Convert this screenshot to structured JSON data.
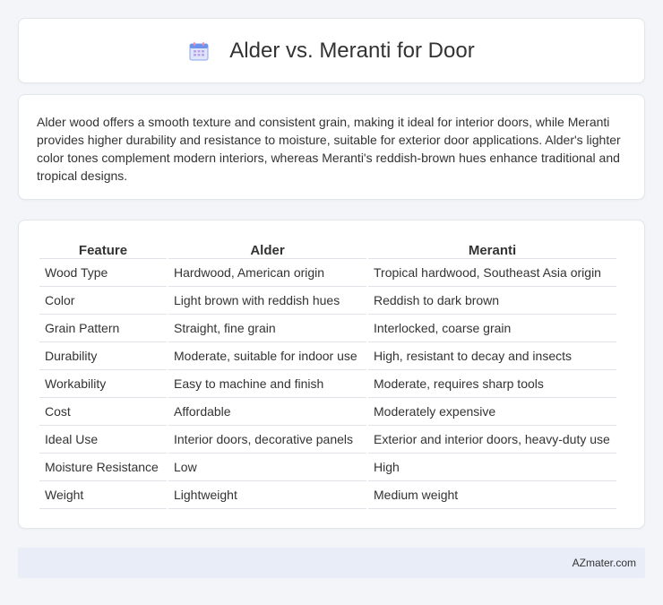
{
  "header": {
    "title": "Alder vs. Meranti for Door",
    "icon": "calendar-icon"
  },
  "description": {
    "text": "Alder wood offers a smooth texture and consistent grain, making it ideal for interior doors, while Meranti provides higher durability and resistance to moisture, suitable for exterior door applications. Alder's lighter color tones complement modern interiors, whereas Meranti's reddish-brown hues enhance traditional and tropical designs."
  },
  "table": {
    "headers": [
      "Feature",
      "Alder",
      "Meranti"
    ],
    "rows": [
      [
        "Wood Type",
        "Hardwood, American origin",
        "Tropical hardwood, Southeast Asia origin"
      ],
      [
        "Color",
        "Light brown with reddish hues",
        "Reddish to dark brown"
      ],
      [
        "Grain Pattern",
        "Straight, fine grain",
        "Interlocked, coarse grain"
      ],
      [
        "Durability",
        "Moderate, suitable for indoor use",
        "High, resistant to decay and insects"
      ],
      [
        "Workability",
        "Easy to machine and finish",
        "Moderate, requires sharp tools"
      ],
      [
        "Cost",
        "Affordable",
        "Moderately expensive"
      ],
      [
        "Ideal Use",
        "Interior doors, decorative panels",
        "Exterior and interior doors, heavy-duty use"
      ],
      [
        "Moisture Resistance",
        "Low",
        "High"
      ],
      [
        "Weight",
        "Lightweight",
        "Medium weight"
      ]
    ]
  },
  "footer": {
    "text": "AZmater.com"
  },
  "colors": {
    "background": "#f3f5f9",
    "card": "#ffffff",
    "footer_bg": "#e8edf7",
    "icon_blue": "#5b8def",
    "icon_pink": "#f28fb0"
  }
}
